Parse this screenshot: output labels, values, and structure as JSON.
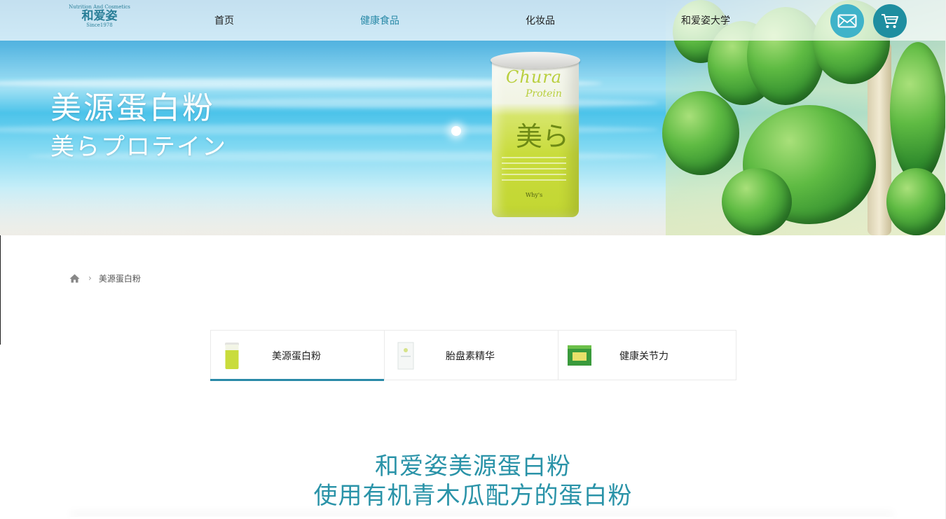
{
  "brand": {
    "tagline": "Nutrition And Cosmetics",
    "name": "和爱姿",
    "since": "Since1978"
  },
  "nav": {
    "items": [
      {
        "label": "首页",
        "active": false
      },
      {
        "label": "健康食品",
        "active": true
      },
      {
        "label": "化妆品",
        "active": false
      },
      {
        "label": "和爱姿大学",
        "active": false
      }
    ],
    "mail_icon": "mail-icon",
    "cart_icon": "cart-icon"
  },
  "hero": {
    "title": "美源蛋白粉",
    "subtitle": "美らプロテイン",
    "product": {
      "script_line1": "Chura",
      "script_line2": "Protein",
      "kanji": "美ら",
      "brand": "Why's"
    }
  },
  "breadcrumb": {
    "home_icon": "home-icon",
    "separator_icon": "chevron-right-icon",
    "current": "美源蛋白粉"
  },
  "tabs": [
    {
      "label": "美源蛋白粉",
      "active": true,
      "thumb_color": "#c9dc3c"
    },
    {
      "label": "胎盘素精华",
      "active": false,
      "thumb_color": "#f3f5f4"
    },
    {
      "label": "健康关节力",
      "active": false,
      "thumb_color": "#3a9a3c"
    }
  ],
  "headline": {
    "line1": "和爱姿美源蛋白粉",
    "line2": "使用有机青木瓜配方的蛋白粉"
  },
  "colors": {
    "accent": "#2a8aa8",
    "headline": "#2a93a8",
    "mail_button": "#3fb3c9",
    "cart_button": "#1f8ea0"
  }
}
